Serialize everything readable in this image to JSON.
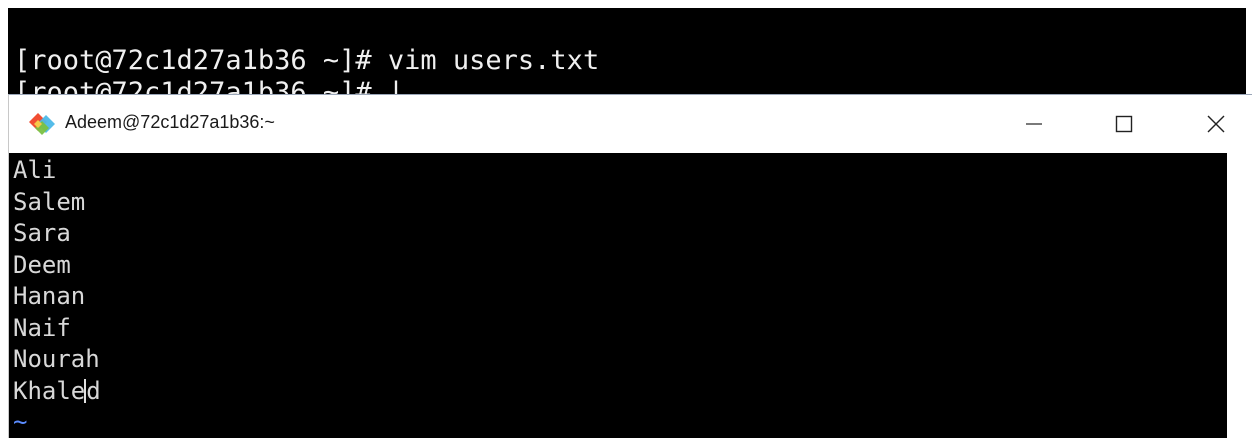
{
  "background_terminal": {
    "line1": "[root@72c1d27a1b36 ~]# vim users.txt",
    "line2": "[root@72c1d27a1b36 ~]# |"
  },
  "window": {
    "title": "Adeem@72c1d27a1b36:~",
    "icon": "git-bash-diamond-icon",
    "controls": {
      "minimize": "—",
      "maximize": "☐",
      "close": "✕"
    }
  },
  "editor": {
    "lines_before_cursor": [
      "Ali",
      "Salem",
      "Sara",
      "Deem",
      "Hanan",
      "Naif",
      "Nourah"
    ],
    "cursor_line_prefix": "Khale",
    "cursor_line_suffix": "d",
    "empty_line_marker": "~"
  },
  "colors": {
    "terminal_bg": "#000000",
    "terminal_text": "#d8d8d8",
    "tilde": "#5b8cff",
    "titlebar_bg": "#ffffff"
  }
}
